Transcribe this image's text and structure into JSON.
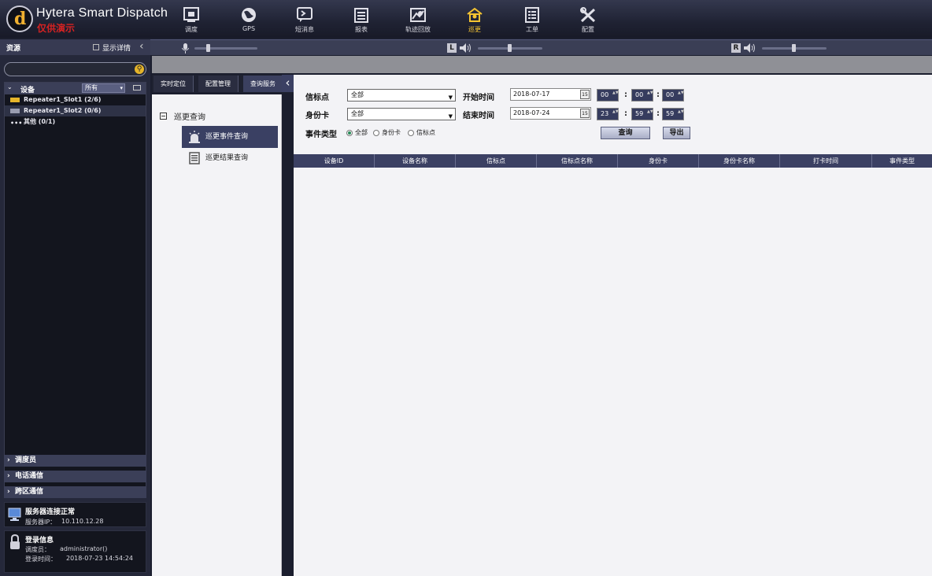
{
  "header": {
    "brand": "Hytera Smart Dispatch",
    "demo_tag": "仅供演示",
    "nav": [
      {
        "label": "调度",
        "icon": "dispatch-icon"
      },
      {
        "label": "GPS",
        "icon": "globe-icon"
      },
      {
        "label": "短消息",
        "icon": "message-icon"
      },
      {
        "label": "报表",
        "icon": "report-icon"
      },
      {
        "label": "轨迹回放",
        "icon": "map-track-icon"
      },
      {
        "label": "巡更",
        "icon": "patrol-icon"
      },
      {
        "label": "工单",
        "icon": "work-order-icon"
      },
      {
        "label": "配置",
        "icon": "tools-icon"
      }
    ],
    "active_nav": "巡更",
    "active_color": "#f5c431",
    "volume": {
      "left_channel_label": "L",
      "right_channel_label": "R"
    }
  },
  "sidebar": {
    "title": "资源",
    "show_details": "显示详情",
    "devices": {
      "title": "设备",
      "filter": "所有",
      "items": [
        {
          "label": "Repeater1_Slot1 (2/6)"
        },
        {
          "label": "Repeater1_Slot2 (0/6)"
        },
        {
          "label": "其他 (0/1)"
        }
      ]
    },
    "groups": [
      "调度员",
      "电话通信",
      "跨区通信"
    ],
    "server": {
      "title": "服务器连接正常",
      "ip_label": "服务器IP：",
      "ip": "10.110.12.28"
    },
    "login": {
      "title": "登录信息",
      "dispatcher_label": "调度员：",
      "dispatcher": "administrator()",
      "time_label": "登录时间：",
      "time": "2018-07-23 14:54:24"
    }
  },
  "tabs": [
    "实时定位",
    "配置管理",
    "查询服务"
  ],
  "nav_panel": {
    "root": "巡更查询",
    "items": [
      "巡更事件查询",
      "巡更结果查询"
    ]
  },
  "form": {
    "beacon_label": "信标点",
    "beacon_value": "全部",
    "card_label": "身份卡",
    "card_value": "全部",
    "start_label": "开始时间",
    "start_date": "2018-07-17",
    "start_h": "00",
    "start_m": "00",
    "start_s": "00",
    "end_label": "结束时间",
    "end_date": "2018-07-24",
    "end_h": "23",
    "end_m": "59",
    "end_s": "59",
    "date_icon_text": "15",
    "event_type_label": "事件类型",
    "event_types": [
      "全部",
      "身份卡",
      "信标点"
    ],
    "query_button": "查询",
    "export_button": "导出"
  },
  "table": {
    "columns": [
      "设备ID",
      "设备名称",
      "信标点",
      "信标点名称",
      "身份卡",
      "身份卡名称",
      "打卡时间",
      "事件类型"
    ]
  }
}
